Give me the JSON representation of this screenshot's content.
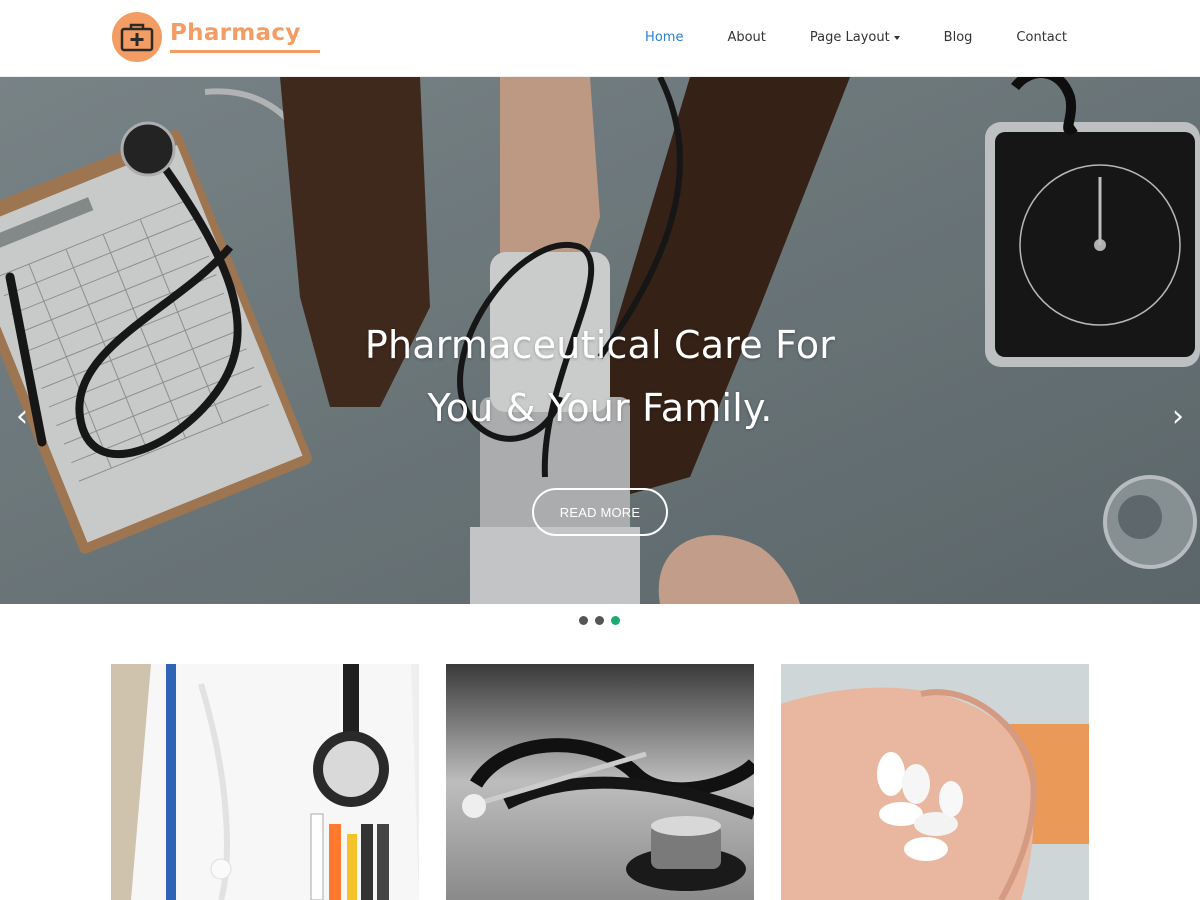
{
  "brand": {
    "name": "Pharmacy",
    "logo_icon": "medical-kit-icon",
    "accent_color": "#f39c63"
  },
  "nav": {
    "items": [
      {
        "label": "Home",
        "active": true
      },
      {
        "label": "About"
      },
      {
        "label": "Page Layout",
        "dropdown": true
      },
      {
        "label": "Blog"
      },
      {
        "label": "Contact"
      }
    ],
    "active_color": "#2a7fd4"
  },
  "hero": {
    "title_line1": "Pharmaceutical Care For",
    "title_line2": "You & Your Family.",
    "button_label": "READ MORE",
    "prev_icon": "chevron-left-icon",
    "next_icon": "chevron-right-icon",
    "prev_glyph": "‹",
    "next_glyph": "›"
  },
  "slider": {
    "slide_count": 3,
    "active_index": 2,
    "active_color": "#1aaa73"
  },
  "features": {
    "cards": [
      {
        "image": "doctor-stethoscope-photo"
      },
      {
        "image": "stethoscope-bw-photo"
      },
      {
        "image": "pills-in-hand-photo"
      }
    ]
  }
}
